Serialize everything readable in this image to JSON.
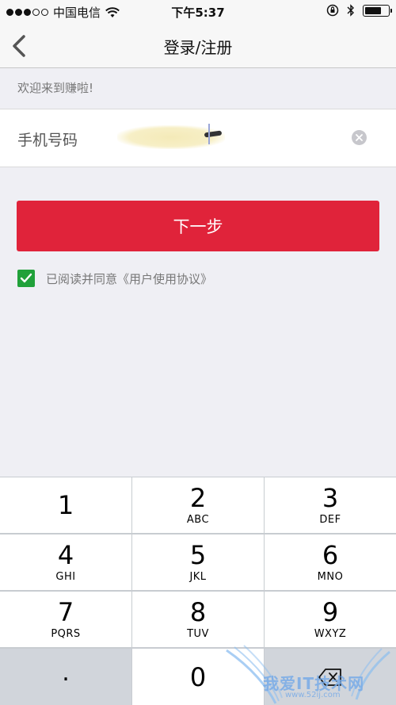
{
  "status_bar": {
    "carrier": "中国电信",
    "time": "下午5:37",
    "signal_bars_filled": 3,
    "signal_bars_total": 5,
    "battery_level": 0.7,
    "icons": [
      "wifi-icon",
      "rotation-lock-icon",
      "bluetooth-icon",
      "battery-icon"
    ]
  },
  "nav": {
    "title": "登录/注册",
    "back_icon": "chevron-left-icon"
  },
  "welcome": "欢迎来到赚啦!",
  "phone_field": {
    "label": "手机号码",
    "value": "",
    "clear_icon": "clear-icon"
  },
  "next_button": {
    "label": "下一步",
    "color": "#e0233a"
  },
  "agreement": {
    "checked": true,
    "text": "已阅读并同意《用户使用协议》",
    "check_color": "#21a13a"
  },
  "keypad": {
    "keys": [
      {
        "digit": "1",
        "letters": ""
      },
      {
        "digit": "2",
        "letters": "ABC"
      },
      {
        "digit": "3",
        "letters": "DEF"
      },
      {
        "digit": "4",
        "letters": "GHI"
      },
      {
        "digit": "5",
        "letters": "JKL"
      },
      {
        "digit": "6",
        "letters": "MNO"
      },
      {
        "digit": "7",
        "letters": "PQRS"
      },
      {
        "digit": "8",
        "letters": "TUV"
      },
      {
        "digit": "9",
        "letters": "WXYZ"
      },
      {
        "digit": ".",
        "letters": ""
      },
      {
        "digit": "0",
        "letters": ""
      },
      {
        "digit": "",
        "letters": "",
        "icon": "backspace-icon"
      }
    ]
  },
  "watermark": {
    "text": "我爱IT技术网",
    "url": "www.52ij.com"
  }
}
